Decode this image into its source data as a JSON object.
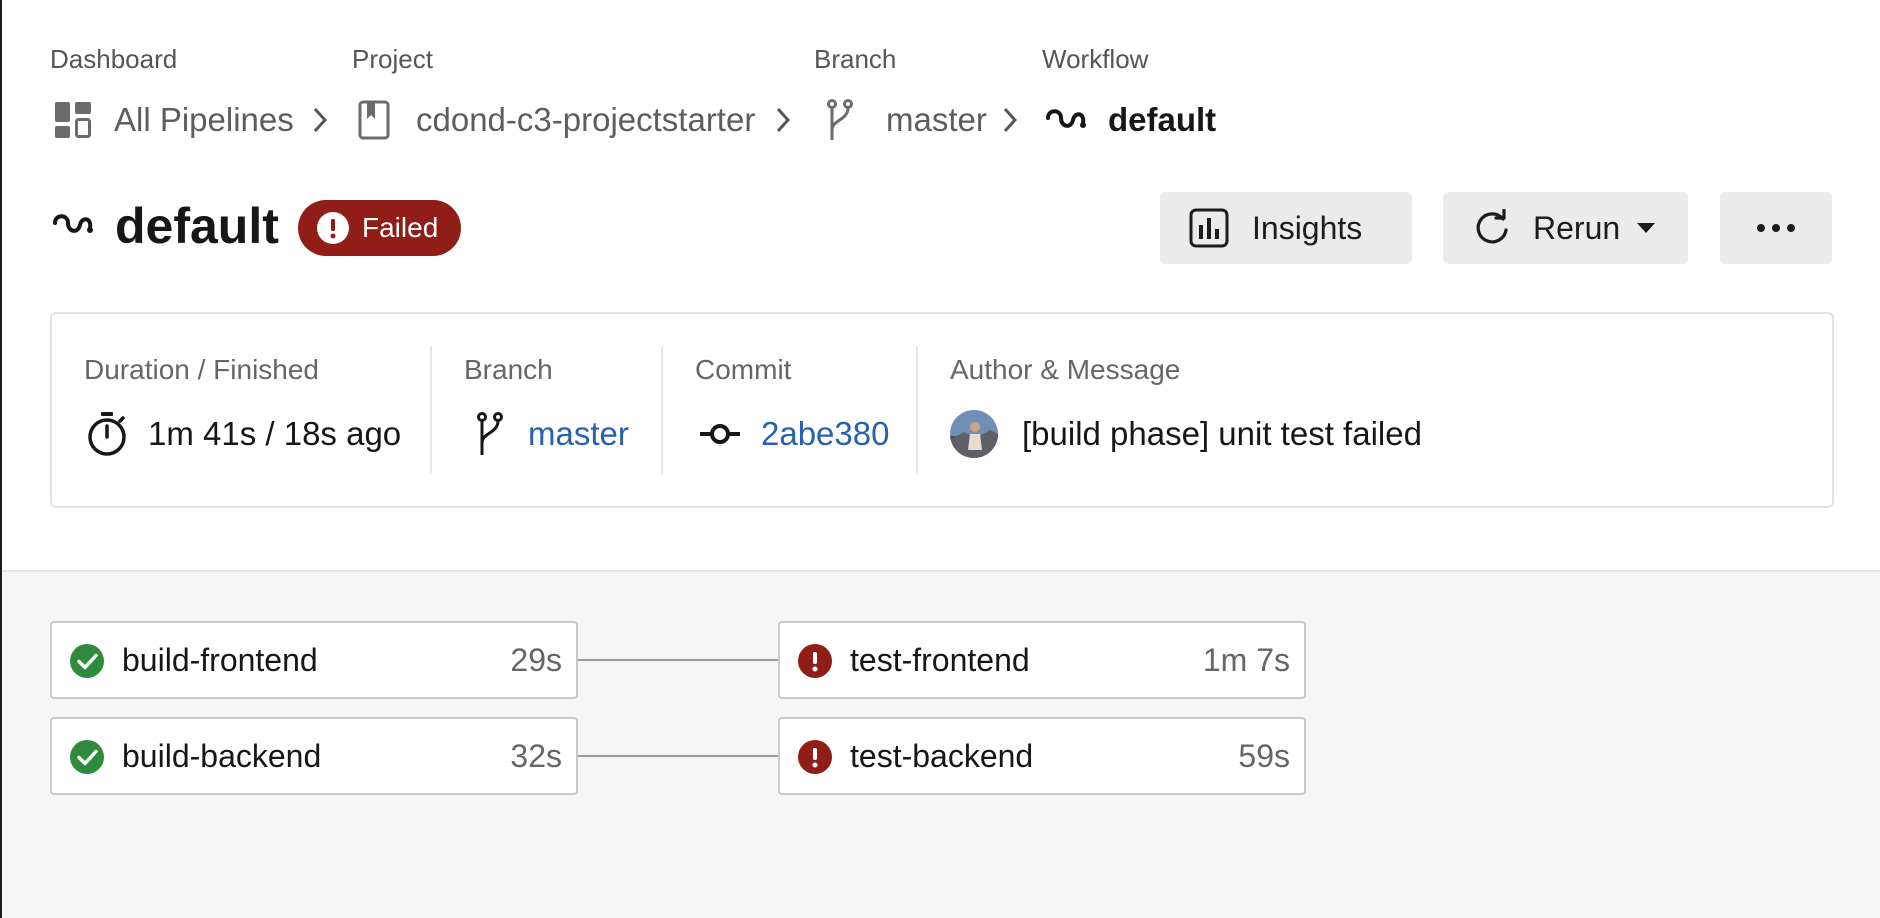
{
  "breadcrumb": {
    "dashboard": {
      "caption": "Dashboard",
      "label": "All Pipelines",
      "icon": "dashboard-icon"
    },
    "project": {
      "caption": "Project",
      "label": "cdond-c3-projectstarter",
      "icon": "repo-icon"
    },
    "branch": {
      "caption": "Branch",
      "label": "master",
      "icon": "branch-icon"
    },
    "workflow": {
      "caption": "Workflow",
      "label": "default",
      "icon": "workflow-icon"
    }
  },
  "header": {
    "title": "default",
    "status": "Failed",
    "buttons": {
      "insights": "Insights",
      "rerun": "Rerun"
    }
  },
  "summary": {
    "duration": {
      "caption": "Duration / Finished",
      "value": "1m 41s / 18s ago"
    },
    "branch": {
      "caption": "Branch",
      "value": "master"
    },
    "commit": {
      "caption": "Commit",
      "value": "2abe380"
    },
    "author": {
      "caption": "Author & Message",
      "message": "[build phase] unit test failed"
    }
  },
  "jobs": [
    {
      "name": "build-frontend",
      "duration": "29s",
      "status": "success"
    },
    {
      "name": "build-backend",
      "duration": "32s",
      "status": "success"
    },
    {
      "name": "test-frontend",
      "duration": "1m 7s",
      "status": "failed"
    },
    {
      "name": "test-backend",
      "duration": "59s",
      "status": "failed"
    }
  ],
  "colors": {
    "failed": "#901d18",
    "success": "#2e8b3d",
    "link": "#2760b3"
  }
}
